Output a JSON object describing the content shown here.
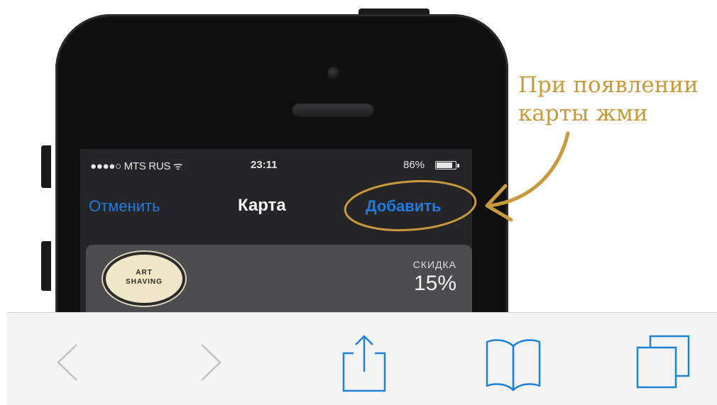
{
  "status_bar": {
    "carrier": "●●●●○ MTS RUS ᯤ",
    "time": "23:11",
    "battery": "86%",
    "battery_level": 0.86
  },
  "nav_bar": {
    "cancel_label": "Отменить",
    "title": "Карта",
    "add_label": "Добавить"
  },
  "card": {
    "logo_text_1": "ART",
    "logo_text_2": "SHAVING",
    "discount_label": "СКИДКА",
    "discount_value": "15%"
  },
  "annotation": {
    "text": "При появлении карты жми"
  },
  "toolbar": {
    "back_icon": "chevron-left-icon",
    "forward_icon": "chevron-right-icon",
    "share_icon": "share-icon",
    "bookmarks_icon": "book-icon",
    "tabs_icon": "tabs-icon"
  },
  "colors": {
    "ios_blue": "#1f7ae0",
    "annotation_gold": "#c79a3b",
    "toolbar_blue": "#1e82d9",
    "toolbar_gray": "#c2c2c2"
  }
}
